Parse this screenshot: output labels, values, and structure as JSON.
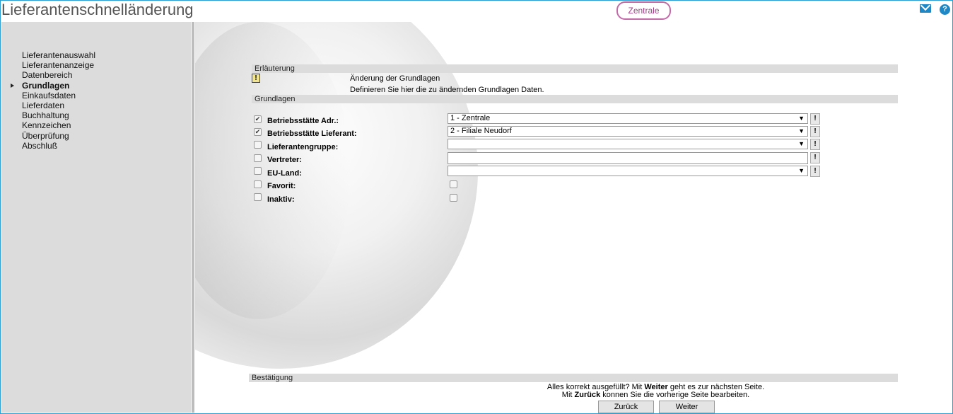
{
  "header": {
    "title": "Lieferantenschnelländerung",
    "branch": "Zentrale",
    "mail_icon": "mail-icon",
    "help_icon": "help-icon",
    "help_glyph": "?"
  },
  "sidebar": {
    "items": [
      {
        "label": "Lieferantenauswahl"
      },
      {
        "label": "Lieferantenanzeige"
      },
      {
        "label": "Datenbereich"
      },
      {
        "label": "Grundlagen",
        "active": true
      },
      {
        "label": "Einkaufsdaten"
      },
      {
        "label": "Lieferdaten"
      },
      {
        "label": "Buchhaltung"
      },
      {
        "label": "Kennzeichen"
      },
      {
        "label": "Überprüfung"
      },
      {
        "label": "Abschluß"
      }
    ]
  },
  "explanation": {
    "header": "Erläuterung",
    "icon_glyph": "!",
    "line1": "Änderung der Grundlagen",
    "line2": "Definieren Sie hier die zu ändernden Grundlagen Daten."
  },
  "grundlagen": {
    "header": "Grundlagen",
    "rows": [
      {
        "label": "Betriebsstätte Adr.:",
        "checked": true,
        "value": "1 - Zentrale"
      },
      {
        "label": "Betriebsstätte Lieferant:",
        "checked": true,
        "value": "2 - Filiale Neudorf"
      },
      {
        "label": "Lieferantengruppe:",
        "checked": false,
        "value": ""
      },
      {
        "label": "Vertreter:",
        "checked": false,
        "value": ""
      },
      {
        "label": "EU-Land:",
        "checked": false,
        "value": ""
      },
      {
        "label": "Favorit:",
        "checked": false
      },
      {
        "label": "Inaktiv:",
        "checked": false
      }
    ],
    "bang_glyph": "!",
    "arrow_glyph": "▼",
    "check_glyph": "✔"
  },
  "confirm": {
    "header": "Bestätigung",
    "line1_a": "Alles korrekt ausgefüllt?  Mit ",
    "line1_b": "Weiter",
    "line1_c": " geht es zur nächsten Seite.",
    "line2_a": "Mit ",
    "line2_b": "Zurück",
    "line2_c": " konnen Sie die vorherige Seite bearbeiten.",
    "back_label": "Zurück",
    "next_label": "Weiter"
  }
}
